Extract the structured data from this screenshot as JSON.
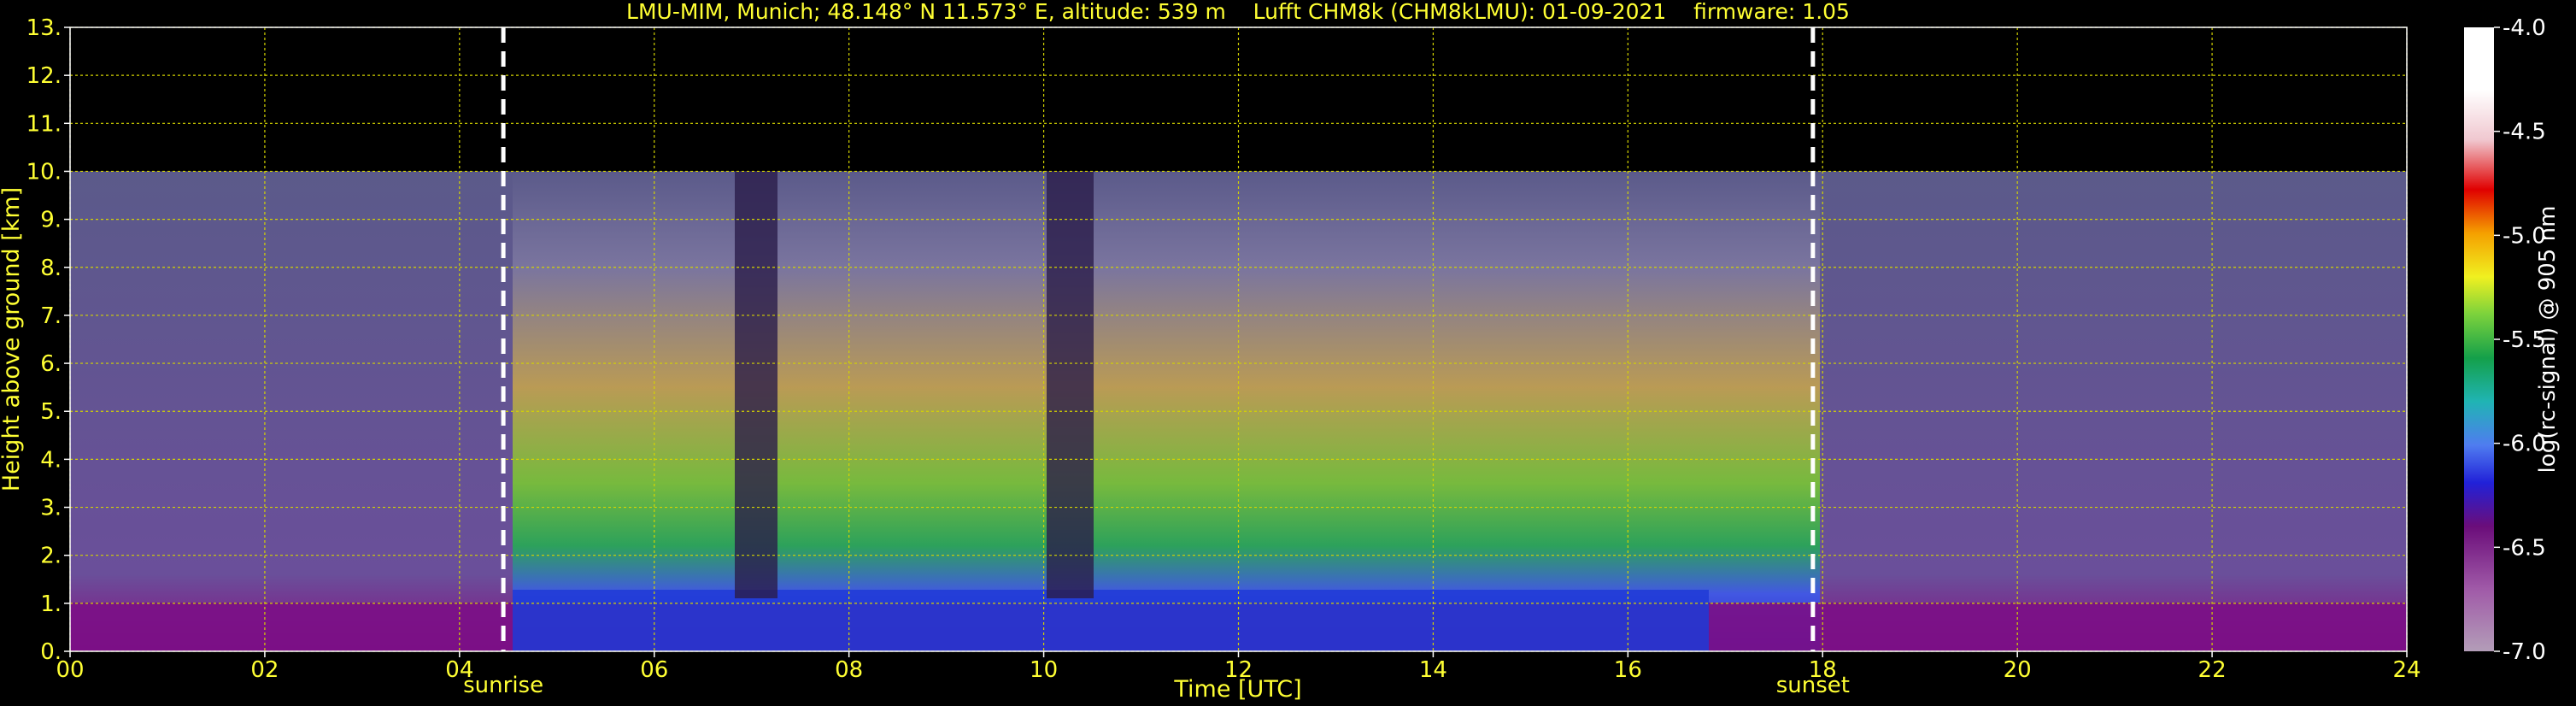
{
  "chart_data": {
    "type": "heatmap",
    "title": "LMU-MIM, Munich; 48.148° N 11.573° E, altitude: 539 m    Lufft CHM8k (CHM8kLMU): 01-09-2021    firmware: 1.05",
    "xlabel": "Time [UTC]",
    "ylabel": "Height above ground [km]",
    "xlim": [
      0,
      24
    ],
    "ylim": [
      0,
      13
    ],
    "x_ticks": [
      "00",
      "02",
      "04",
      "06",
      "08",
      "10",
      "12",
      "14",
      "16",
      "18",
      "20",
      "22",
      "24"
    ],
    "y_ticks": [
      "0.",
      "1.",
      "2.",
      "3.",
      "4.",
      "5.",
      "6.",
      "7.",
      "8.",
      "9.",
      "10.",
      "11.",
      "12.",
      "13."
    ],
    "grid": true,
    "data_top_km": 10,
    "colorbar": {
      "label": "log(rc-signal) @ 905 nm",
      "range": [
        -7.0,
        -4.0
      ],
      "ticks": [
        "-4.0",
        "-4.5",
        "-5.0",
        "-5.5",
        "-6.0",
        "-6.5",
        "-7.0"
      ]
    },
    "markers": [
      {
        "label": "sunrise",
        "time": 4.45
      },
      {
        "label": "sunset",
        "time": 17.9
      }
    ],
    "colors": {
      "text": "#ffff33",
      "background": "#000000",
      "grid": "#d4d400"
    }
  }
}
